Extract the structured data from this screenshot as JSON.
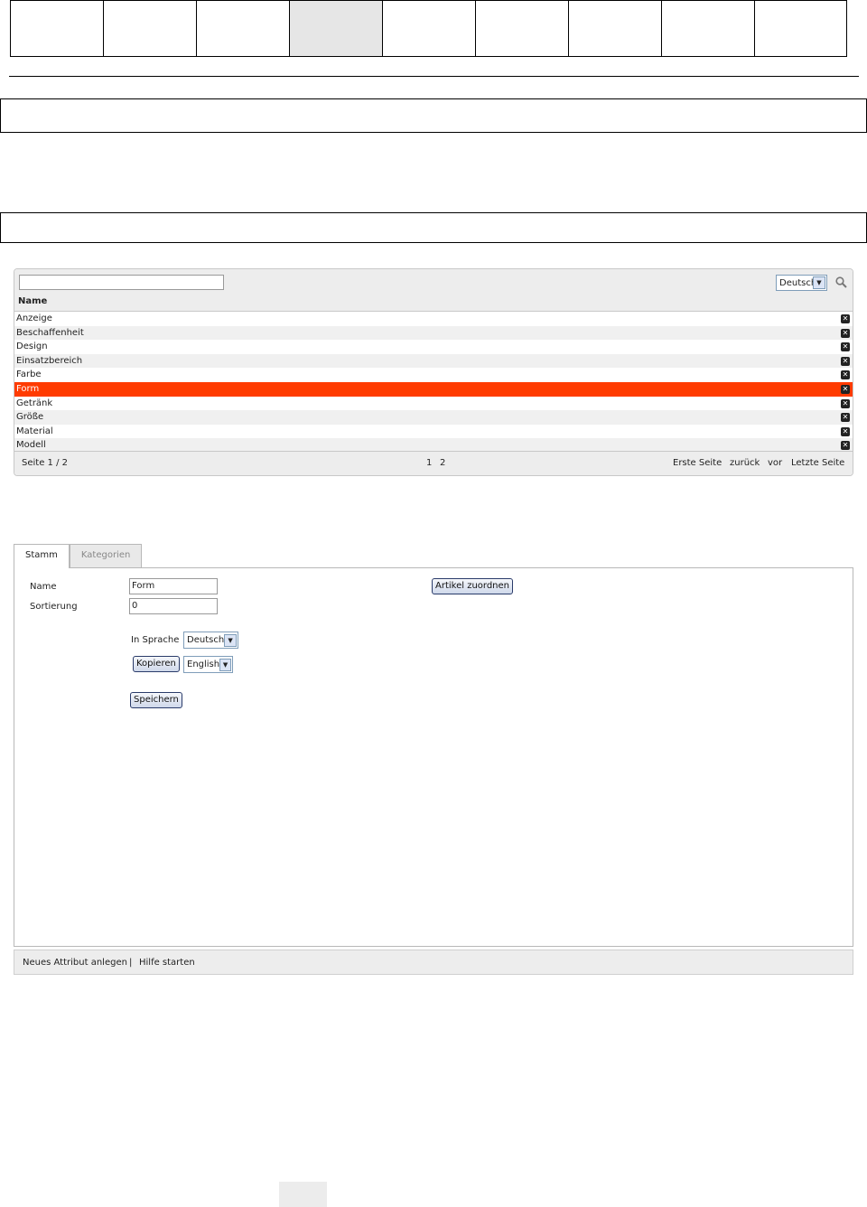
{
  "list": {
    "search_placeholder": "",
    "language": "Deutsch",
    "column_header": "Name",
    "rows": [
      "Anzeige",
      "Beschaffenheit",
      "Design",
      "Einsatzbereich",
      "Farbe",
      "Form",
      "Getränk",
      "Größe",
      "Material",
      "Modell"
    ],
    "selected_row": "Form",
    "delete_glyph": "✕",
    "pager": {
      "page_info": "Seite 1 / 2",
      "page_1": "1",
      "page_2": "2",
      "first": "Erste Seite",
      "back": "zurück",
      "next": "vor",
      "last": "Letzte Seite"
    }
  },
  "tabs": {
    "stamm": "Stamm",
    "kategorien": "Kategorien"
  },
  "form": {
    "name_label": "Name",
    "name_value": "Form",
    "sort_label": "Sortierung",
    "sort_value": "0",
    "assign_button": "Artikel zuordnen",
    "in_language_label": "In Sprache",
    "in_language_value": "Deutsch",
    "copy_button": "Kopieren",
    "copy_language_value": "English",
    "save_button": "Speichern"
  },
  "footer": {
    "new_attribute": "Neues Attribut anlegen",
    "separator": "|",
    "help": "Hilfe starten"
  },
  "colors": {
    "selected_row": "#ff3b00",
    "panel_bg": "#ededed",
    "active_nav": "#e6e6e6"
  }
}
